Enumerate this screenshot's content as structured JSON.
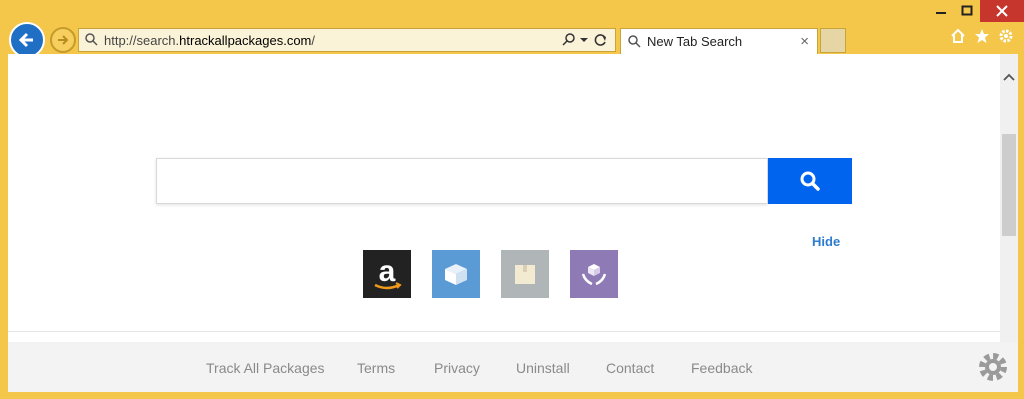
{
  "window": {
    "minimize_icon": "minimize-icon",
    "maximize_icon": "maximize-icon",
    "close_icon": "close-icon"
  },
  "address_bar": {
    "url_prefix": "http://search.",
    "url_domain": "htrackallpackages.com",
    "url_suffix": "/"
  },
  "tab": {
    "title": "New Tab Search",
    "close_symbol": "×"
  },
  "page": {
    "search_placeholder": "",
    "hide_label": "Hide",
    "tiles": [
      {
        "name": "amazon",
        "color": "#222222"
      },
      {
        "name": "package-open",
        "color": "#5b9bd5"
      },
      {
        "name": "package-closed",
        "color": "#b0b5b8"
      },
      {
        "name": "hands-package",
        "color": "#8e7ab5"
      }
    ]
  },
  "footer": {
    "links": [
      "Track All Packages",
      "Terms",
      "Privacy",
      "Uninstall",
      "Contact",
      "Feedback"
    ]
  },
  "colors": {
    "frame": "#f4c64a",
    "search_button": "#0064ee",
    "accent_link": "#2d7cd1"
  }
}
